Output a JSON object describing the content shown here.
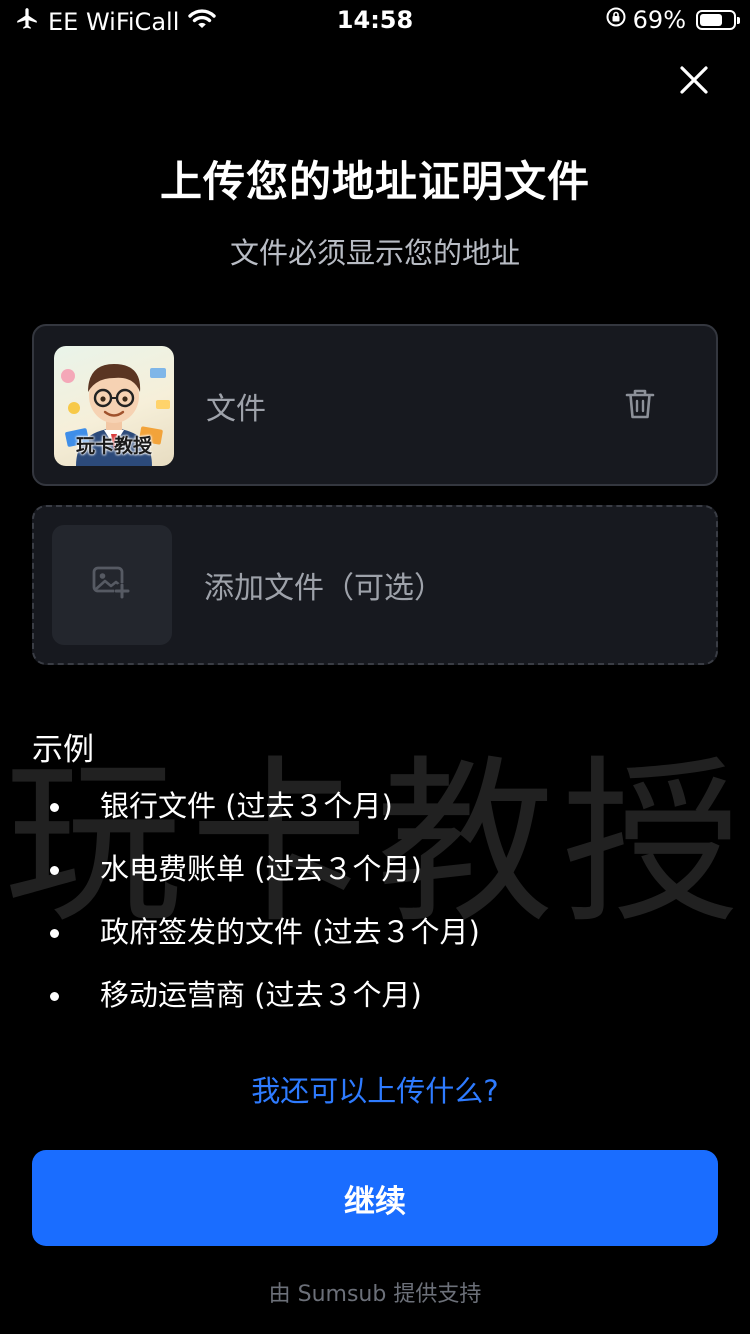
{
  "status_bar": {
    "carrier": "EE WiFiCall",
    "time": "14:58",
    "battery_percent": "69%",
    "battery_level": 0.69,
    "icons": [
      "airplane-icon",
      "wifi-icon",
      "orientation-lock-icon",
      "battery-icon"
    ]
  },
  "header": {
    "title": "上传您的地址证明文件",
    "subtitle": "文件必须显示您的地址"
  },
  "file_card": {
    "thumbnail_text": "玩卡教授",
    "file_label": "文件"
  },
  "add_card": {
    "label": "添加文件（可选）"
  },
  "watermark": "玩卡教授",
  "examples": {
    "heading": "示例",
    "items": [
      "银行文件 (过去３个月)",
      "水电费账单 (过去３个月)",
      "政府签发的文件 (过去３个月)",
      "移动运营商 (过去３个月)"
    ]
  },
  "link": {
    "more": "我还可以上传什么?"
  },
  "actions": {
    "continue": "继续"
  },
  "footer": {
    "powered_by": "由 Sumsub 提供支持"
  },
  "colors": {
    "background": "#000000",
    "card": "#17191f",
    "accent": "#1a6dff",
    "link": "#2e7bff"
  }
}
